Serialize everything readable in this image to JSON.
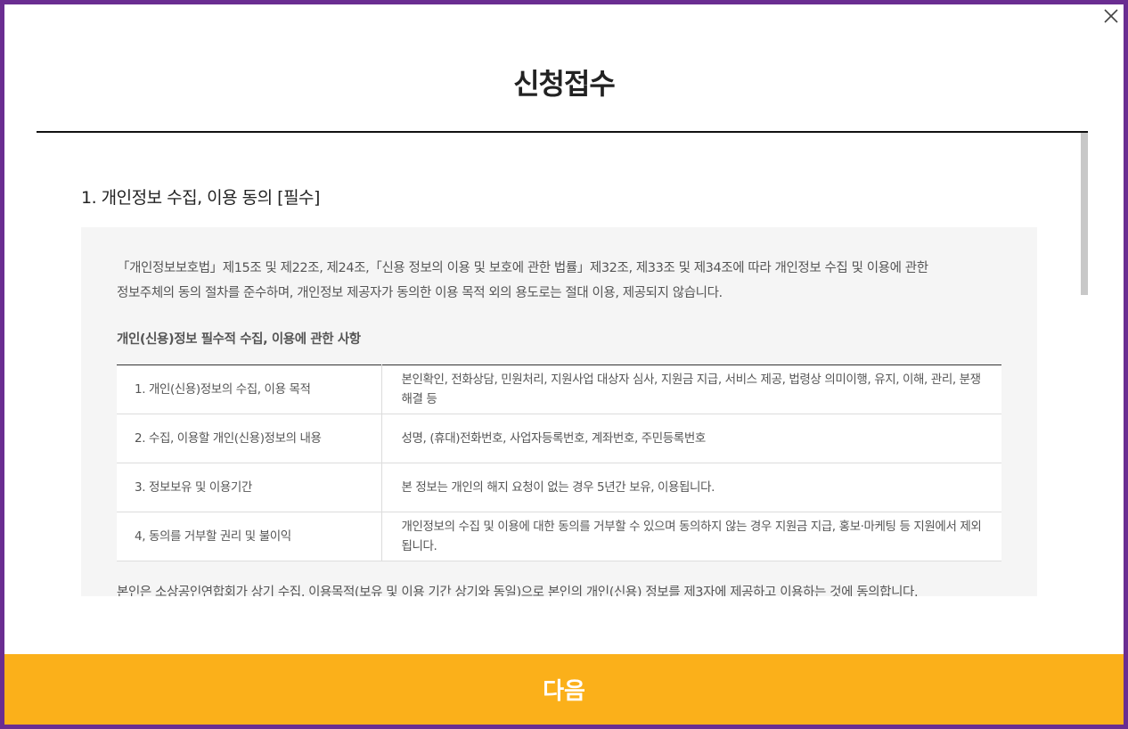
{
  "modal": {
    "title": "신청접수",
    "close_icon": "close-icon"
  },
  "section": {
    "title": "1. 개인정보 수집, 이용 동의 [필수]",
    "intro_line1": "「개인정보보호법」제15조 및 제22조, 제24조,「신용 정보의 이용 및 보호에 관한 법률」제32조, 제33조 및 제34조에 따라 개인정보 수집 및 이용에 관한",
    "intro_line2": "정보주체의 동의 절차를 준수하며, 개인정보 제공자가 동의한 이용 목적 외의 용도로는 절대 이용, 제공되지 않습니다.",
    "sub_title": "개인(신용)정보 필수적 수집, 이용에 관한 사항",
    "table": [
      {
        "key": "1. 개인(신용)정보의 수집, 이용 목적",
        "value": "본인확인, 전화상담, 민원처리, 지원사업 대상자 심사, 지원금 지급, 서비스 제공, 법령상 의미이행, 유지, 이해, 관리, 분쟁해결 등"
      },
      {
        "key": "2. 수집, 이용할 개인(신용)정보의 내용",
        "value": "성명, (휴대)전화번호, 사업자등록번호, 계좌번호, 주민등록번호"
      },
      {
        "key": "3. 정보보유 및 이용기간",
        "value": "본 정보는 개인의 해지 요청이 없는 경우 5년간 보유, 이용됩니다."
      },
      {
        "key": "4, 동의를 거부할 권리 및 불이익",
        "value": "개인정보의 수집 및 이용에 대한 동의를 거부할 수 있으며 동의하지 않는 경우 지원금 지급, 홍보·마케팅 등 지원에서 제외됩니다."
      }
    ],
    "consent": "본인은 소상공인연합회가 상기 수집, 이용목적(보유 및 이용 기간 상기와 동일)으로 본인의 개인(신용) 정보를 제3자에 제공하고 이용하는 것에 동의합니다."
  },
  "footer": {
    "next_label": "다음"
  },
  "colors": {
    "frame": "#6a2d91",
    "button": "#fbb01a",
    "box": "#f5f5f5"
  }
}
